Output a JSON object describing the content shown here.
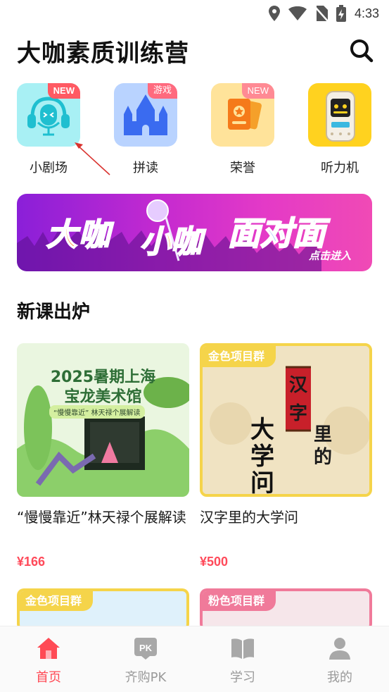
{
  "status_bar": {
    "time": "4:33"
  },
  "header": {
    "title": "大咖素质训练营"
  },
  "quick_entries": [
    {
      "label": "小剧场",
      "badge": "NEW"
    },
    {
      "label": "拼读",
      "badge": "游戏"
    },
    {
      "label": "荣誉",
      "badge": "NEW"
    },
    {
      "label": "听力机",
      "badge": ""
    }
  ],
  "banner": {
    "text_1": "大咖",
    "text_2": "小咖",
    "text_3": "面对面",
    "cta": "点击进入"
  },
  "section": {
    "title": "新课出炉"
  },
  "courses": [
    {
      "title": "“慢慢靠近”林天禄个展解读",
      "price": "¥166",
      "cover_line1": "2025暑期上海",
      "cover_line2": "宝龙美术馆",
      "cover_sub": "“慢慢靠近” 林天禄个展解读"
    },
    {
      "title": "汉字里的大学问",
      "price": "¥500",
      "cover_tag": "金色项目群",
      "cover_big": "大学问",
      "cover_red": "汉字",
      "cover_side": "里的"
    },
    {
      "cover_tag": "金色项目群"
    },
    {
      "cover_tag": "粉色项目群"
    }
  ],
  "bottom_nav": [
    {
      "label": "首页",
      "active": true
    },
    {
      "label": "齐购PK",
      "active": false
    },
    {
      "label": "学习",
      "active": false
    },
    {
      "label": "我的",
      "active": false
    }
  ],
  "colors": {
    "accent": "#ff4a55",
    "price": "#ff4a5a",
    "inactive": "#9a9a9a"
  }
}
